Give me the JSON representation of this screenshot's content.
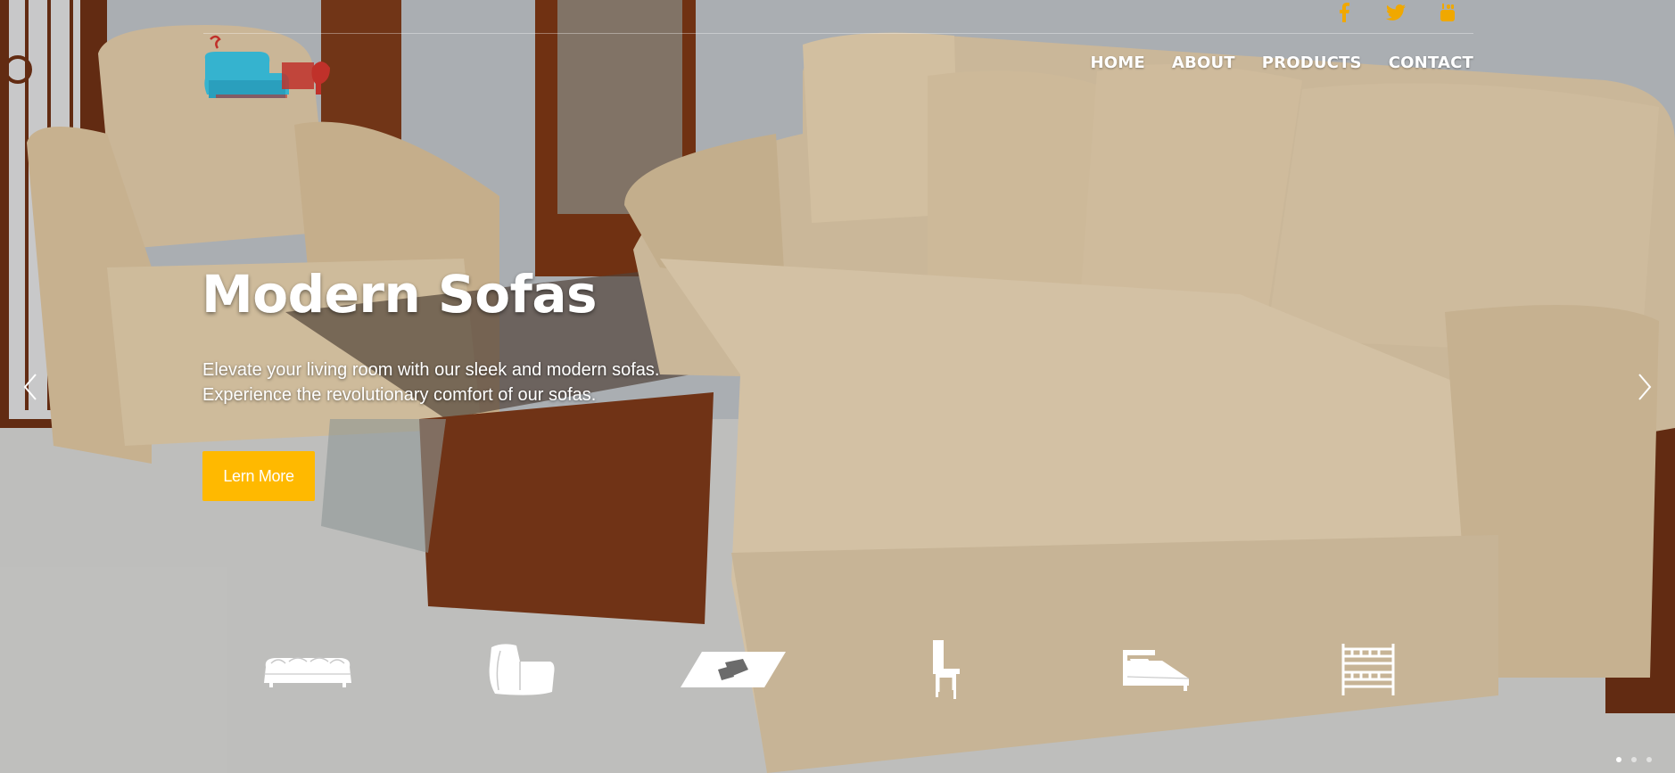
{
  "hero": {
    "title": "Modern Sofas",
    "subtitle_line1": "Elevate your living room with our sleek and modern sofas.",
    "subtitle_line2": "Experience the revolutionary comfort of our sofas.",
    "cta_label": "Lern More"
  },
  "nav": {
    "items": [
      {
        "label": "HOME"
      },
      {
        "label": "ABOUT"
      },
      {
        "label": "PRODUCTS"
      },
      {
        "label": "CONTACT"
      }
    ]
  },
  "social": [
    {
      "icon": "facebook-icon"
    },
    {
      "icon": "twitter-icon"
    },
    {
      "icon": "youtube-icon"
    }
  ],
  "categories": [
    {
      "icon": "sofa-icon"
    },
    {
      "icon": "armchair-icon"
    },
    {
      "icon": "rug-icon"
    },
    {
      "icon": "chair-icon"
    },
    {
      "icon": "bed-icon"
    },
    {
      "icon": "bunk-bed-icon"
    }
  ],
  "carousel": {
    "slide_count": 3,
    "active_index": 0
  },
  "colors": {
    "accent": "#ffb900",
    "social": "#f0a800",
    "text": "#ffffff"
  }
}
